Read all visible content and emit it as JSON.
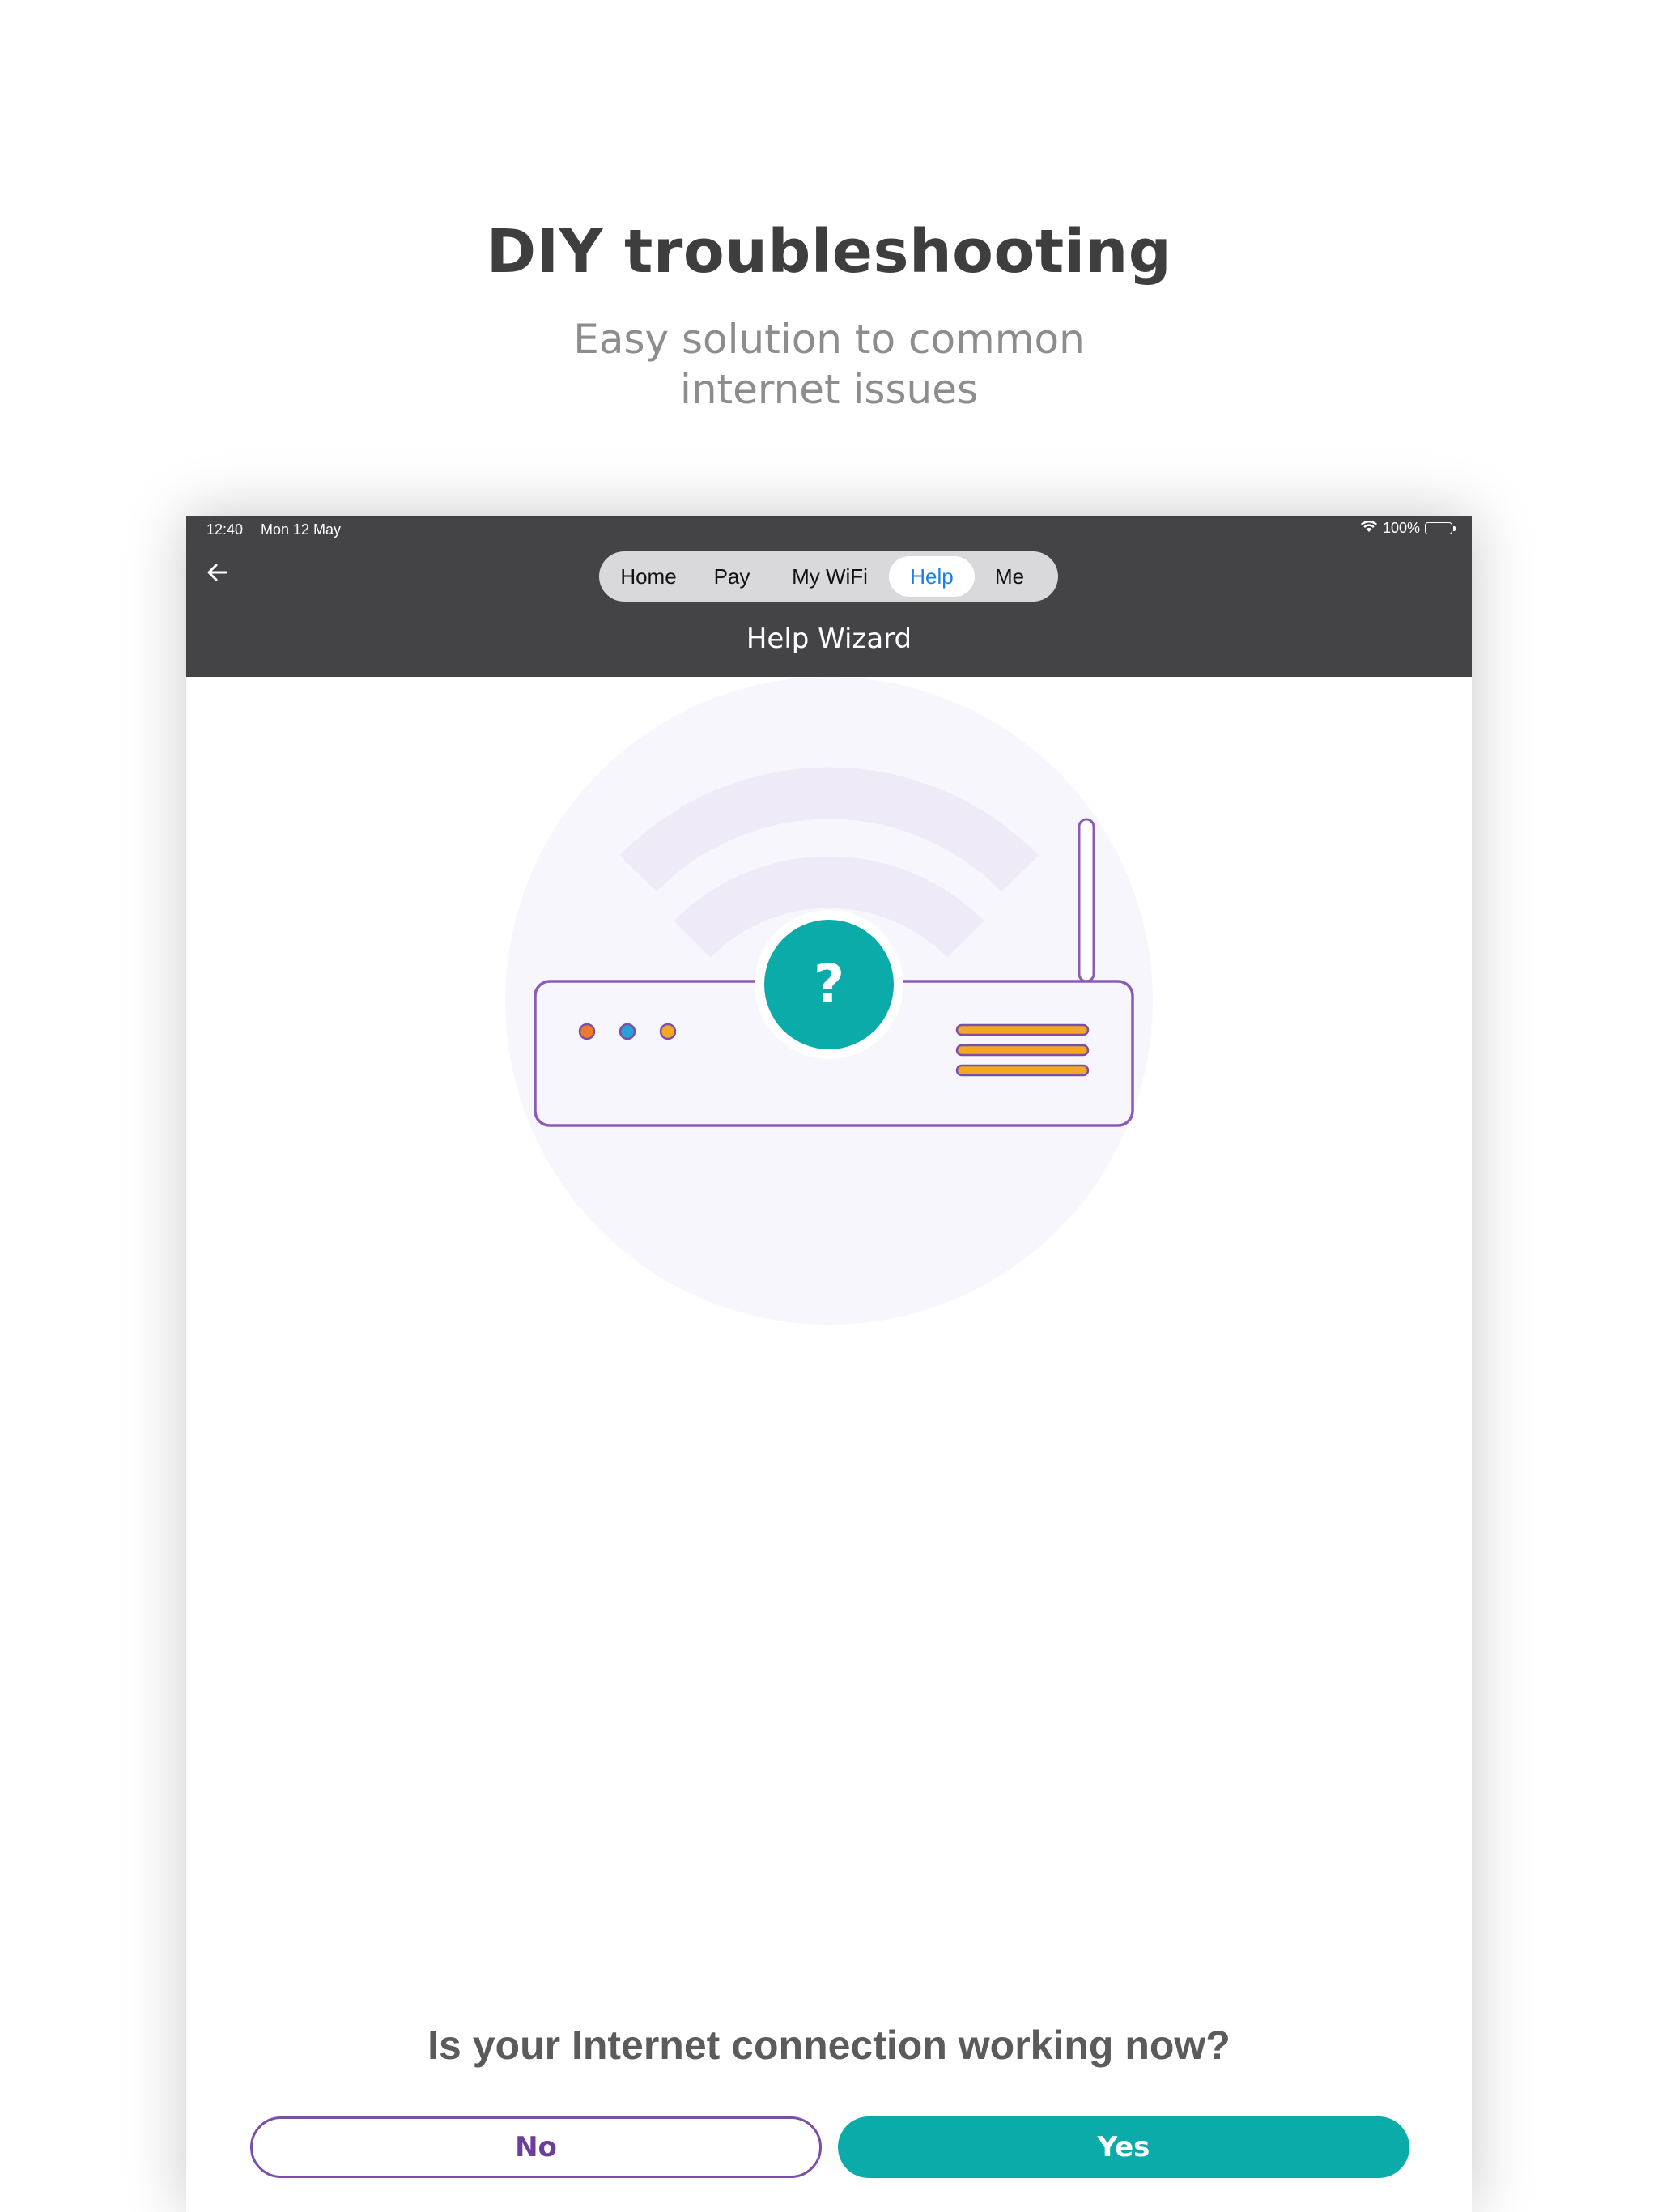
{
  "promo": {
    "title": "DIY troubleshooting",
    "subtitle_line1": "Easy solution to common",
    "subtitle_line2": "internet issues"
  },
  "status_bar": {
    "time": "12:40",
    "date": "Mon 12 May",
    "battery": "100%",
    "icons": [
      "wifi-icon",
      "battery-icon"
    ]
  },
  "nav": {
    "back_icon": "back-arrow-icon",
    "tabs": [
      {
        "label": "Home",
        "active": false
      },
      {
        "label": "Pay",
        "active": false
      },
      {
        "label": "My WiFi",
        "active": false
      },
      {
        "label": "Help",
        "active": true
      },
      {
        "label": "Me",
        "active": false
      }
    ],
    "title": "Help Wizard"
  },
  "illustration": {
    "icon": "router-question-icon",
    "badge_symbol": "?",
    "colors": {
      "teal": "#0aaba9",
      "purple_outline": "#8a5cb5",
      "led_orange": "#f07a2c",
      "led_blue": "#2b9fd9",
      "led_yellow": "#f5a623"
    }
  },
  "wizard": {
    "question": "Is your Internet connection working now?",
    "no_label": "No",
    "yes_label": "Yes"
  },
  "colors": {
    "header_bg": "#444446",
    "accent_teal": "#0aaba9",
    "accent_purple": "#6a3f99",
    "active_tab_text": "#1a7fe6"
  }
}
